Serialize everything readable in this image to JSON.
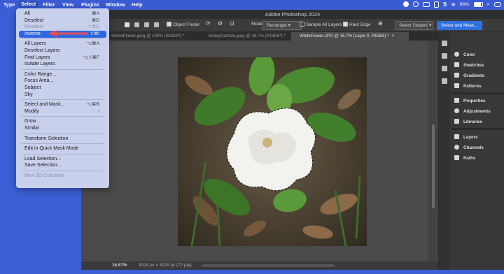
{
  "menubar": {
    "items": [
      "Type",
      "Select",
      "Filter",
      "View",
      "Plugins",
      "Window",
      "Help"
    ],
    "battery": "86%",
    "status_icons": [
      "teams-icon",
      "record-icon",
      "screen-icon",
      "clipboard-icon",
      "s-icon",
      "wifi-icon",
      "battery-icon",
      "search-icon",
      "control-center-icon"
    ]
  },
  "window": {
    "title": "Adobe Photoshop 2024"
  },
  "options": {
    "object_finder": "Object Finder",
    "mode_label": "Mode:",
    "mode_value": "Rectangle",
    "sample_all_layers": "Sample All Layers",
    "hard_edge": "Hard Edge",
    "select_subject": "Select Subject",
    "select_and_mask": "Select and Mask..."
  },
  "tabs": [
    {
      "label": "YellowFlower.jpeg @ 100% (RGB/8*) *",
      "active": false
    },
    {
      "label": "BaileyOutside.jpeg @ 16.7% (RGB/8*) *",
      "active": false
    },
    {
      "label": "WhiteFlower.JPG @ 16.7% (Layer 0, RGB/8) *",
      "active": true
    }
  ],
  "statusbar": {
    "zoom": "16.67%",
    "doc_info": "3024 px x 3029 px (72 ppi)"
  },
  "panels": {
    "group1": [
      "Color",
      "Swatches",
      "Gradients",
      "Patterns"
    ],
    "group2": [
      "Properties",
      "Adjustments",
      "Libraries"
    ],
    "group3": [
      "Layers",
      "Channels",
      "Paths"
    ]
  },
  "select_menu": {
    "items": [
      {
        "label": "All",
        "shortcut": "⌘A",
        "disabled": false
      },
      {
        "label": "Deselect",
        "shortcut": "⌘D",
        "disabled": false
      },
      {
        "label": "Reselect",
        "shortcut": "⇧⌘D",
        "disabled": true
      },
      {
        "label": "Inverse",
        "shortcut": "⇧⌘I",
        "disabled": false,
        "highlighted": true
      },
      {
        "sep": true
      },
      {
        "label": "All Layers",
        "shortcut": "⌥⌘A",
        "disabled": false
      },
      {
        "label": "Deselect Layers",
        "shortcut": "",
        "disabled": false
      },
      {
        "label": "Find Layers",
        "shortcut": "⌥⇧⌘F",
        "disabled": false
      },
      {
        "label": "Isolate Layers",
        "shortcut": "",
        "disabled": false
      },
      {
        "sep": true
      },
      {
        "label": "Color Range...",
        "shortcut": "",
        "disabled": false
      },
      {
        "label": "Focus Area...",
        "shortcut": "",
        "disabled": false
      },
      {
        "label": "Subject",
        "shortcut": "",
        "disabled": false
      },
      {
        "label": "Sky",
        "shortcut": "",
        "disabled": false
      },
      {
        "sep": true
      },
      {
        "label": "Select and Mask...",
        "shortcut": "⌥⌘R",
        "disabled": false
      },
      {
        "label": "Modify",
        "shortcut": "›",
        "disabled": false
      },
      {
        "sep": true
      },
      {
        "label": "Grow",
        "shortcut": "",
        "disabled": false
      },
      {
        "label": "Similar",
        "shortcut": "",
        "disabled": false
      },
      {
        "sep": true
      },
      {
        "label": "Transform Selection",
        "shortcut": "",
        "disabled": false
      },
      {
        "sep": true
      },
      {
        "label": "Edit in Quick Mask Mode",
        "shortcut": "",
        "disabled": false
      },
      {
        "sep": true
      },
      {
        "label": "Load Selection...",
        "shortcut": "",
        "disabled": false
      },
      {
        "label": "Save Selection...",
        "shortcut": "",
        "disabled": false
      },
      {
        "sep": true
      },
      {
        "label": "New 3D Extrusion",
        "shortcut": "",
        "disabled": true
      }
    ]
  },
  "colors": {
    "desktop": "#3b5fd6",
    "highlight": "#2c66e0",
    "arrow": "#e0505a"
  }
}
